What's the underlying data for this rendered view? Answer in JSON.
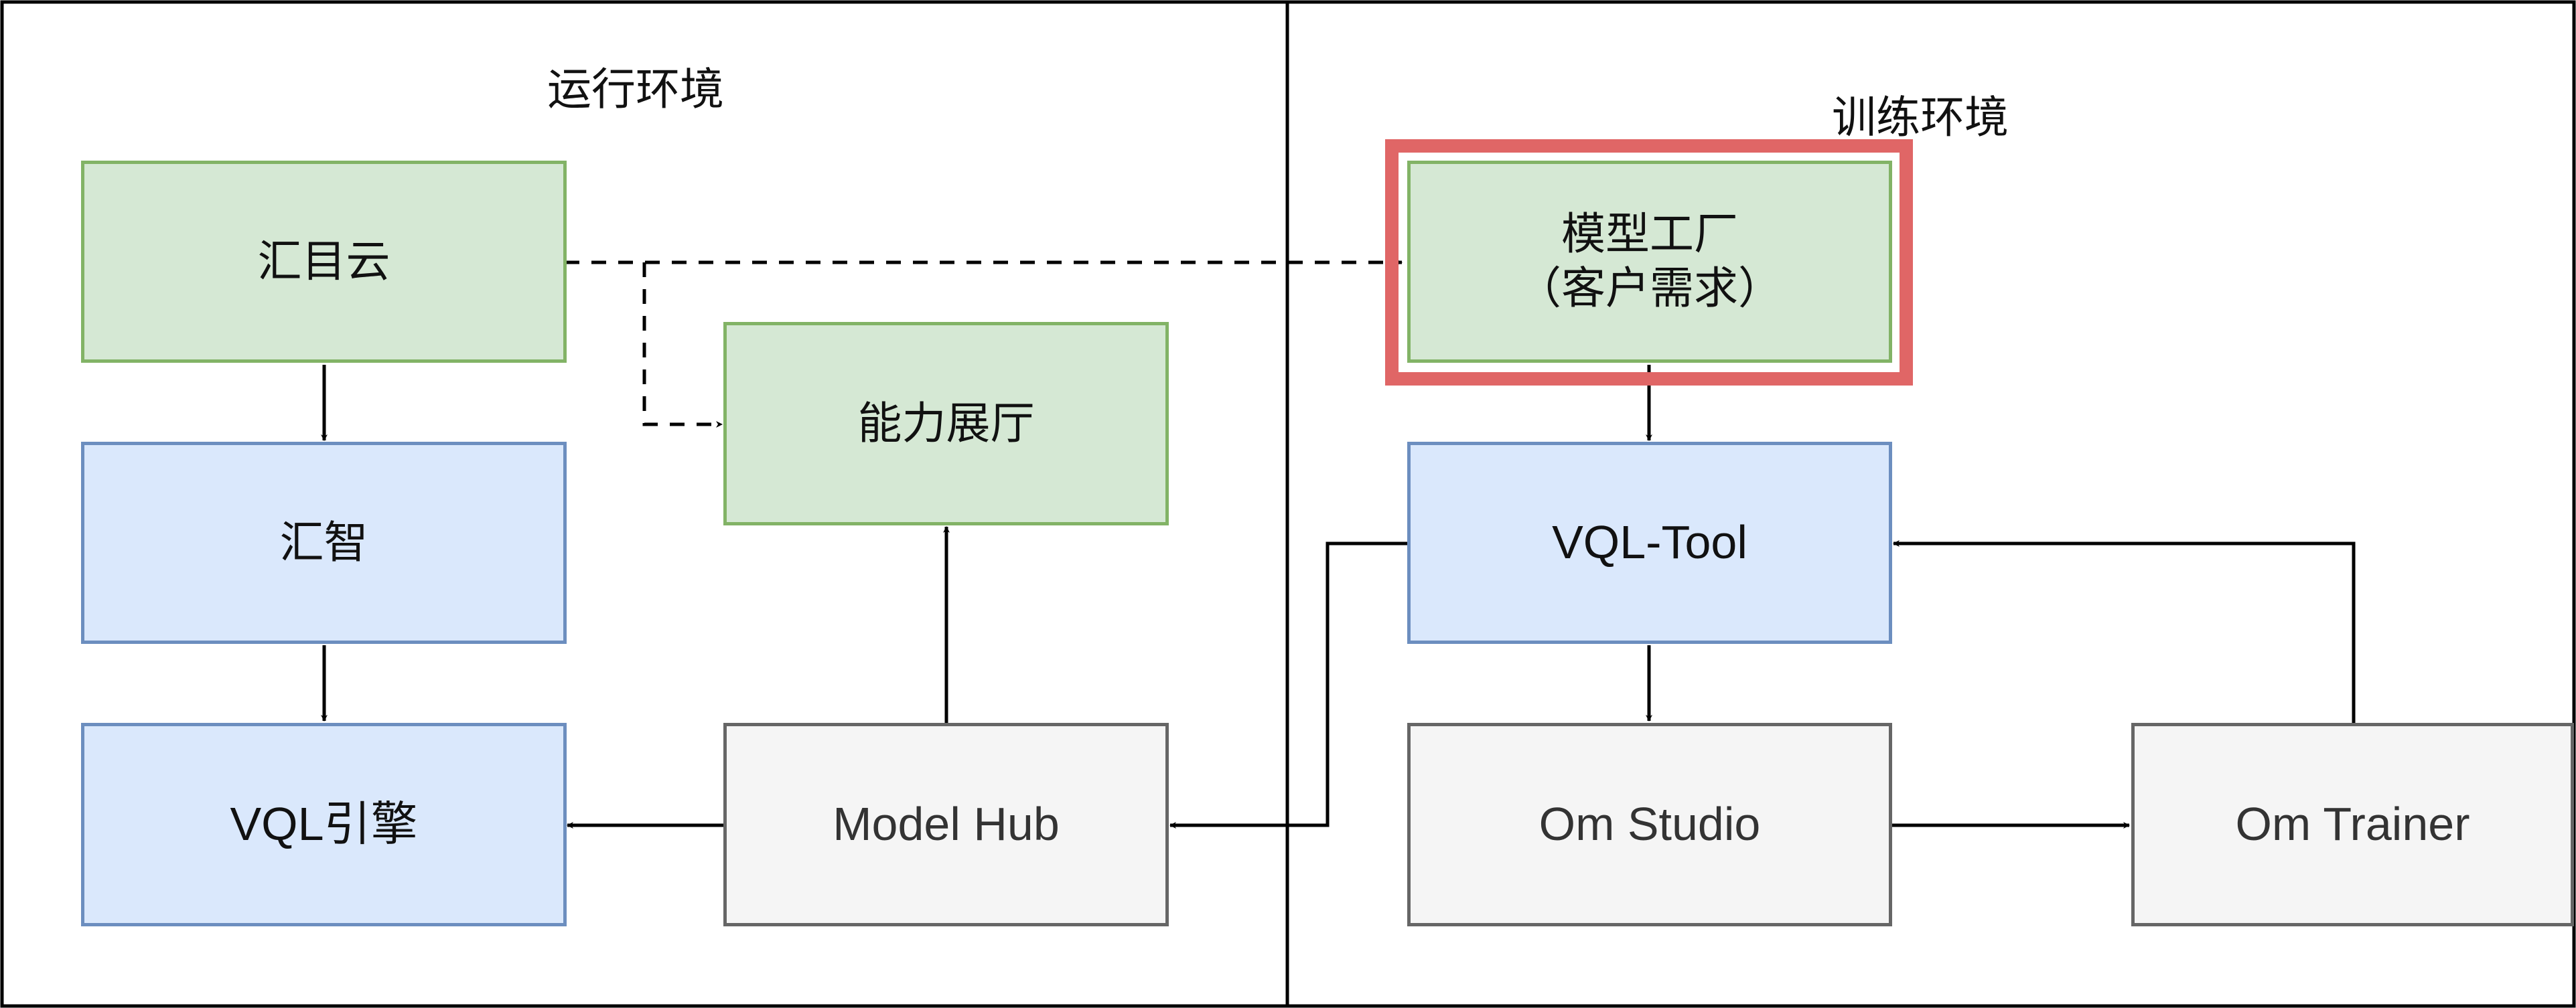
{
  "environments": {
    "runtime": {
      "label": "运行环境"
    },
    "training": {
      "label": "训练环境"
    }
  },
  "nodes": {
    "huimuyun": "汇目云",
    "nengli_zhanting": "能力展厅",
    "huizhi": "汇智",
    "vql_engine": "VQL引擎",
    "model_hub": "Model Hub",
    "model_factory": "模型工厂\n（客户需求）",
    "vql_tool": "VQL-Tool",
    "om_studio": "Om Studio",
    "om_trainer": "Om Trainer"
  },
  "colors": {
    "green_fill": "#d5e8d4",
    "green_stroke": "#82b366",
    "blue_fill": "#dae8fc",
    "blue_stroke": "#6c8ebf",
    "gray_fill": "#f5f5f5",
    "gray_stroke": "#666666",
    "highlight": "#e06666",
    "edge": "#000000"
  },
  "edges": [
    {
      "from": "huimuyun",
      "to": "model_factory",
      "style": "dashed"
    },
    {
      "from": "huimuyun",
      "to": "nengli_zhanting",
      "style": "dashed"
    },
    {
      "from": "huimuyun",
      "to": "huizhi",
      "style": "solid"
    },
    {
      "from": "huizhi",
      "to": "vql_engine",
      "style": "solid"
    },
    {
      "from": "model_hub",
      "to": "vql_engine",
      "style": "solid"
    },
    {
      "from": "model_hub",
      "to": "nengli_zhanting",
      "style": "solid"
    },
    {
      "from": "model_factory",
      "to": "vql_tool",
      "style": "solid"
    },
    {
      "from": "vql_tool",
      "to": "om_studio",
      "style": "solid"
    },
    {
      "from": "vql_tool",
      "to": "model_hub",
      "style": "solid"
    },
    {
      "from": "om_studio",
      "to": "om_trainer",
      "style": "solid"
    },
    {
      "from": "om_trainer",
      "to": "vql_tool",
      "style": "solid"
    }
  ],
  "highlighted_node": "model_factory"
}
